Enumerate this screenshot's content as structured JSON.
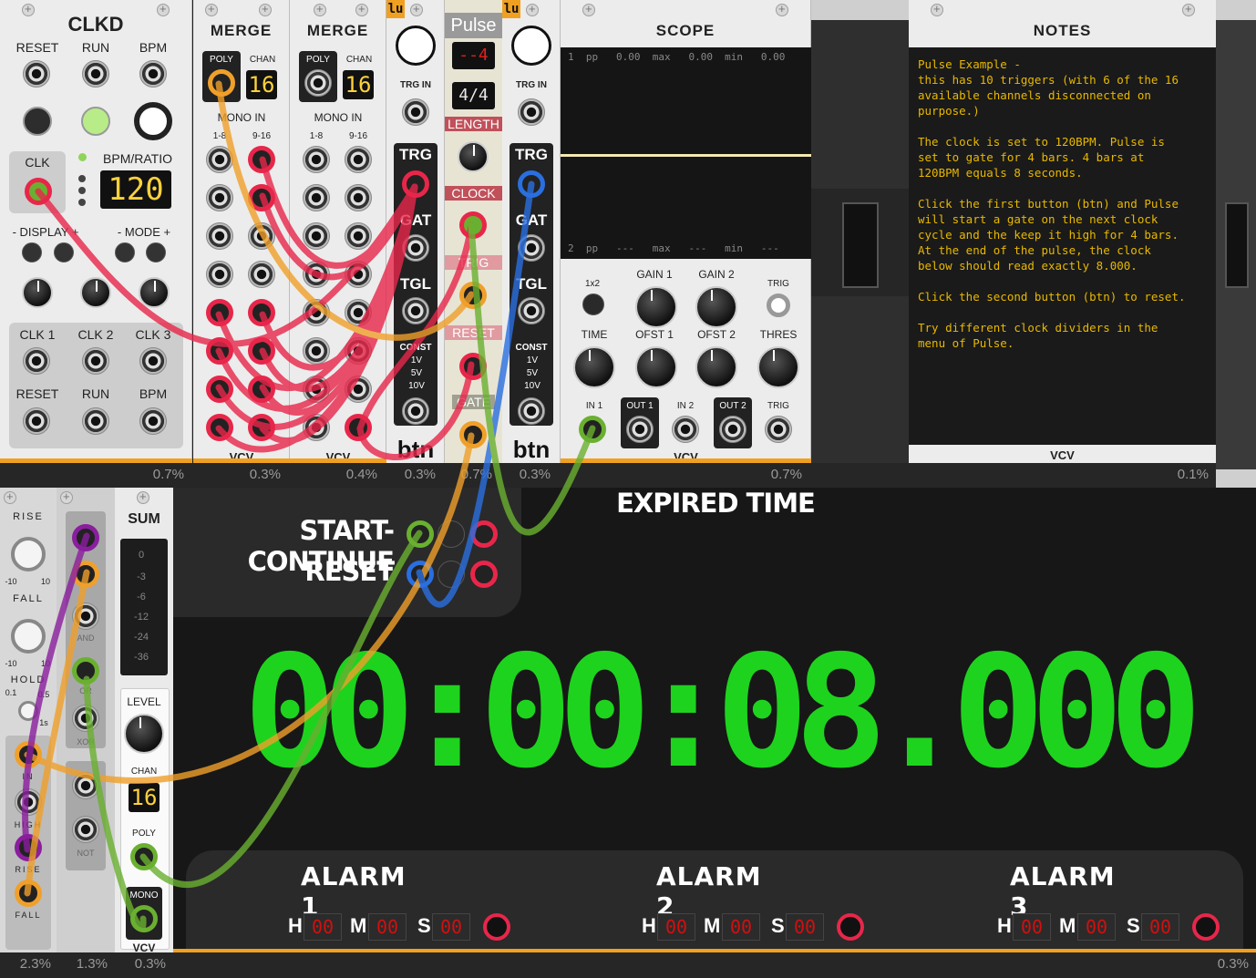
{
  "colors": {
    "cable_red": "#e8264a",
    "cable_orange": "#f0a02a",
    "cable_green": "#6ab030",
    "cable_blue": "#2a6fe0",
    "cable_purple": "#8a1e9e",
    "timer_green": "#1fe31f",
    "notes_yellow": "#e8b800"
  },
  "clkd": {
    "title": "CLKD",
    "reset": "RESET",
    "run": "RUN",
    "bpm": "BPM",
    "clk": "CLK",
    "bpm_ratio": "BPM/RATIO",
    "bpm_display": "120",
    "display": "- DISPLAY +",
    "mode": "- MODE +",
    "outs": [
      "CLK 1",
      "CLK 2",
      "CLK 3"
    ],
    "outs2": [
      "RESET",
      "RUN",
      "BPM"
    ],
    "cpu": "0.7%"
  },
  "merge1": {
    "title": "MERGE",
    "poly": "POLY",
    "chan": "CHAN",
    "chan_value": "16",
    "mono_in": "MONO IN",
    "col1": "1-8",
    "col2": "9-16",
    "brand": "VCV",
    "cpu": "0.3%"
  },
  "merge2": {
    "title": "MERGE",
    "poly": "POLY",
    "chan": "CHAN",
    "chan_value": "16",
    "mono_in": "MONO IN",
    "col1": "1-8",
    "col2": "9-16",
    "brand": "VCV",
    "cpu": "0.4%"
  },
  "btn1": {
    "badge": "lu",
    "trg_in": "TRG IN",
    "trg": "TRG",
    "gat": "GAT",
    "tgl": "TGL",
    "const": "CONST",
    "v1": "1V",
    "v5": "5V",
    "v10": "10V",
    "name": "btn",
    "cpu": "0.3%"
  },
  "pulse": {
    "badge": "lu",
    "title": "Pulse",
    "display1": "--4",
    "display2": "4/4",
    "length": "LENGTH",
    "clock": "CLOCK",
    "trig": "TRIG",
    "reset": "RESET",
    "gate": "GATE",
    "cpu": "0.7%"
  },
  "btn2": {
    "badge": "lu",
    "trg_in": "TRG IN",
    "trg": "TRG",
    "gat": "GAT",
    "tgl": "TGL",
    "const": "CONST",
    "v1": "1V",
    "v5": "5V",
    "v10": "10V",
    "name": "btn",
    "cpu": "0.3%"
  },
  "scope": {
    "title": "SCOPE",
    "row1": "1  pp   0.00  max   0.00  min   0.00",
    "row2": "2  pp   ---   max   ---   min   ---",
    "x1": "1x2",
    "gain1": "GAIN 1",
    "gain2": "GAIN 2",
    "trig": "TRIG",
    "time": "TIME",
    "ofst1": "OFST 1",
    "ofst2": "OFST 2",
    "thres": "THRES",
    "in1": "IN 1",
    "out1": "OUT 1",
    "in2": "IN 2",
    "out2": "OUT 2",
    "trig2": "TRIG",
    "brand": "VCV",
    "cpu": "0.7%"
  },
  "notes": {
    "title": "NOTES",
    "text": "Pulse Example -\nthis has 10 triggers (with 6 of the 16\navailable channels disconnected on\npurpose.)\n\nThe clock is set to 120BPM. Pulse is\nset to gate for 4 bars. 4 bars at\n120BPM equals 8 seconds.\n\nClick the first button (btn) and Pulse\nwill start a gate on the next clock\ncycle and the keep it high for 4 bars.\nAt the end of the pulse, the clock\nbelow should read exactly 8.000.\n\nClick the second button (btn) to reset.\n\nTry different clock dividers in the\nmenu of Pulse.",
    "brand": "VCV",
    "cpu": "0.1%"
  },
  "env": {
    "rise": "RISE",
    "fall": "FALL",
    "hold": "HOLD",
    "h01": "0.1",
    "h05": "0.5",
    "h1s": "1s",
    "in": "IN",
    "high": "HIGH",
    "rise2": "RISE",
    "fall2": "FALL",
    "lo": "-10",
    "hi": "10",
    "cpu": "2.3%"
  },
  "logic": {
    "and": "AND",
    "or": "OR",
    "xor": "XOR",
    "not": "NOT",
    "cpu": "1.3%"
  },
  "sum": {
    "title": "SUM",
    "meter": [
      "0",
      "-3",
      "-6",
      "-12",
      "-24",
      "-36"
    ],
    "level": "LEVEL",
    "chan": "CHAN",
    "chan_value": "16",
    "poly": "POLY",
    "mono": "MONO",
    "brand": "VCV",
    "cpu": "0.3%"
  },
  "timer": {
    "expired": "EXPIRED TIME",
    "start": "START-CONTINUE",
    "reset": "RESET",
    "time": "00:00:08.000",
    "alarms": [
      "ALARM 1",
      "ALARM 2",
      "ALARM 3"
    ],
    "h": "H",
    "m": "M",
    "s": "S",
    "hv": "00",
    "mv": "00",
    "sv": "00",
    "cpu": "0.3%"
  }
}
